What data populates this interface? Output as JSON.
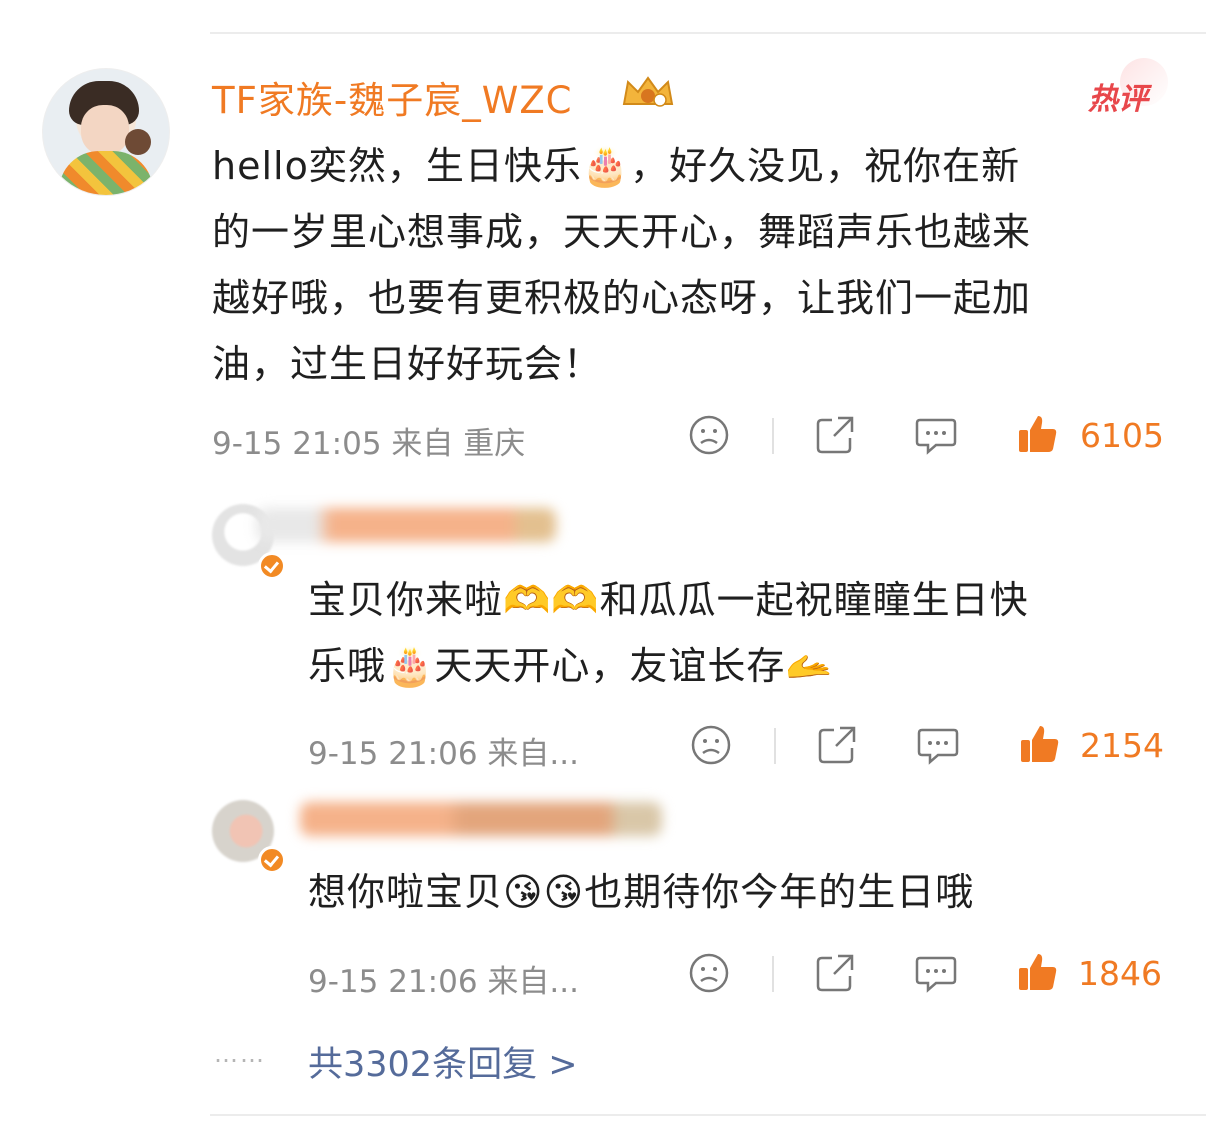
{
  "comment": {
    "username": "TF家族-魏子宸_WZC",
    "hot_badge": "热评",
    "text_lines": [
      "hello奕然，生日快乐🎂，好久没见，祝你在新",
      "的一岁里心想事成，天天开心，舞蹈声乐也越来",
      "越好哦，也要有更积极的心态呀，让我们一起加",
      "油，过生日好好玩会！"
    ],
    "meta": "9-15 21:05 来自 重庆",
    "likes": "6105"
  },
  "replies": [
    {
      "text_lines": [
        "宝贝你来啦🫶🫶和瓜瓜一起祝瞳瞳生日快",
        "乐哦🎂天天开心，友谊长存🫴"
      ],
      "meta": "9-15 21:06 来自...",
      "likes": "2154"
    },
    {
      "text_lines": [
        "想你啦宝贝😘😘也期待你今年的生日哦"
      ],
      "meta": "9-15 21:06 来自...",
      "likes": "1846"
    }
  ],
  "more": {
    "dots": "……",
    "label": "共3302条回复 >"
  },
  "colors": {
    "accent": "#f07a23",
    "link": "#556b9a",
    "meta": "#8c8c8c",
    "hot": "#e8474b"
  }
}
